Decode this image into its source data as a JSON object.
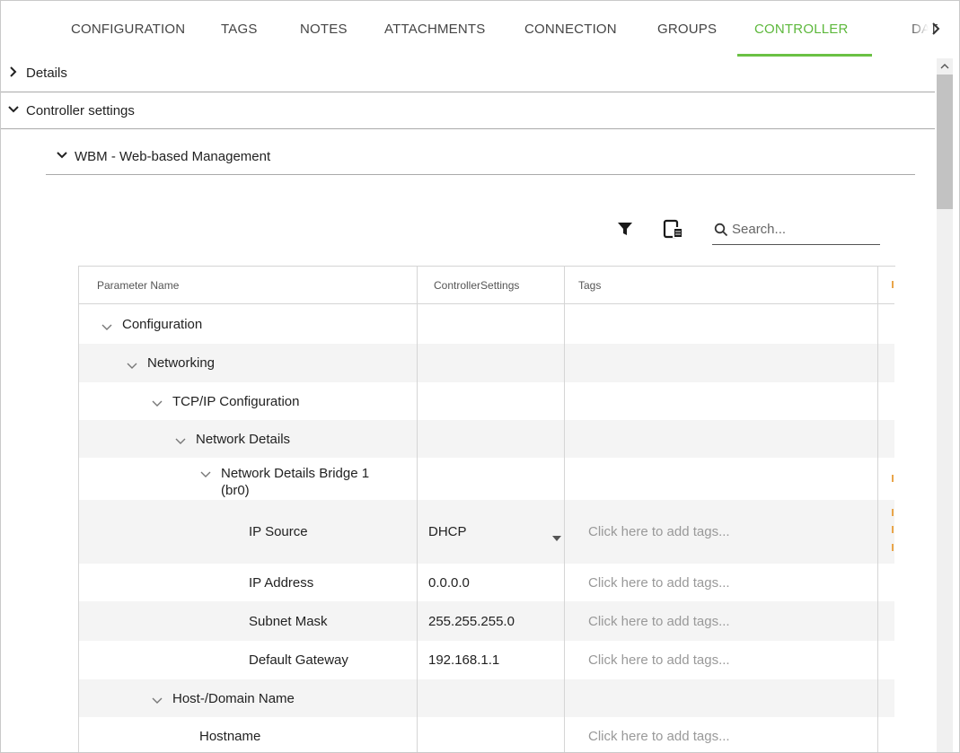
{
  "tabs": [
    {
      "label": "CONFIGURATION",
      "active": false
    },
    {
      "label": "TAGS",
      "active": false
    },
    {
      "label": "NOTES",
      "active": false
    },
    {
      "label": "ATTACHMENTS",
      "active": false
    },
    {
      "label": "CONNECTION",
      "active": false
    },
    {
      "label": "GROUPS",
      "active": false
    },
    {
      "label": "CONTROLLER",
      "active": true
    },
    {
      "label": "DAT",
      "active": false
    }
  ],
  "accent_color": "#6ac144",
  "sections": {
    "details": "Details",
    "controller_settings": "Controller settings",
    "wbm": "WBM - Web-based Management"
  },
  "toolbar": {
    "search_placeholder": "Search..."
  },
  "table": {
    "headers": [
      "Parameter Name",
      "ControllerSettings",
      "Tags"
    ],
    "rows": [
      {
        "name": "Configuration",
        "value": "",
        "tags": ""
      },
      {
        "name": "Networking",
        "value": "",
        "tags": ""
      },
      {
        "name": "TCP/IP Configuration",
        "value": "",
        "tags": ""
      },
      {
        "name": "Network Details",
        "value": "",
        "tags": ""
      },
      {
        "name": "Network Details Bridge 1 (br0)",
        "value": "",
        "tags": ""
      },
      {
        "name": "IP Source",
        "value": "DHCP",
        "tags": "Click here to add tags..."
      },
      {
        "name": "IP Address",
        "value": "0.0.0.0",
        "tags": "Click here to add tags..."
      },
      {
        "name": "Subnet Mask",
        "value": "255.255.255.0",
        "tags": "Click here to add tags..."
      },
      {
        "name": "Default Gateway",
        "value": "192.168.1.1",
        "tags": "Click here to add tags..."
      },
      {
        "name": "Host-/Domain Name",
        "value": "",
        "tags": ""
      },
      {
        "name": "Hostname",
        "value": "",
        "tags": "Click here to add tags..."
      }
    ]
  }
}
